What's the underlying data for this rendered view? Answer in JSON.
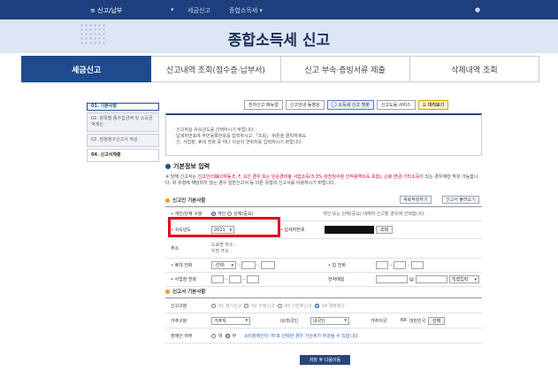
{
  "topnav": {
    "menu_label": "≡  신고/납부",
    "dropdown_mark": "▾",
    "link1": "세금신고",
    "link2": "종합소득세 ▾",
    "circle_mark": "●"
  },
  "banner": {
    "title": "종합소득세 신고"
  },
  "tabs": [
    {
      "label": "세금신고",
      "active": true
    },
    {
      "label": "신고내역 조회(접수증·납부서)",
      "active": false
    },
    {
      "label": "신고 부속·증빙서류 제출",
      "active": false
    },
    {
      "label": "삭제내역 조회",
      "active": false
    }
  ],
  "sidebar": [
    {
      "label": "01. 기본사항"
    },
    {
      "label": "02. 항목별 종수입금액 및 소득금액계산"
    },
    {
      "label": "03. 정정청구신고서 작성"
    },
    {
      "label": "04. 신고서제출"
    }
  ],
  "toolbar": [
    {
      "label": "전자신고 매뉴얼"
    },
    {
      "label": "신고안내 동영상"
    },
    {
      "label": "💬 소득세 신고 챗봇"
    },
    {
      "label": "신고도움 서비스"
    },
    {
      "label": "☰ 미리보기"
    }
  ],
  "info": {
    "line1": "· 신고하실 귀속년도를 선택하시기 바랍니다.",
    "line2": "· 납세자번호에 주민등록번호를 입력하시고 「조회」 버튼을 클릭하세요.",
    "line3": "· 신, 사업장, 휴대 전화 중 하나 이상의 연락처를 입력하시기 바랍니다."
  },
  "section_basic": {
    "title": "기본정보 입력"
  },
  "notice": {
    "prefix": "※ 당해 신고서는 ",
    "red1": "신고인(대표)/자동 E, F, G인 경우 또는 단순경비율 사업소득(3.3% 원천징수된 인적용역소득 포함), 근로·연금·기타소득",
    "suffix": "이 있는 경우에만 작성 가능합니다. 위 유형에 해당되지 않는 경우 일반신고서 등 다른 유형의 신고서를 이용하시기 바랍니다."
  },
  "section_reporter": {
    "title": "신고인 기본사항",
    "new_button": "새로작성하기",
    "load_button": "신고서 불러오기"
  },
  "form": {
    "type_label": "개인/단체 구분",
    "type_opt1": "개인",
    "type_opt2": "단체(중요)",
    "type_note": "개인 또는 단체(중요) 대해여 신고할 경우에 선택합니다.",
    "year_label": "귀속년도",
    "year_value": "2021",
    "taxpayer_label": "납세자번호",
    "lookup_button": "조회",
    "address_label": "주소",
    "address_line1": "도로명 주소 :",
    "address_line2": "지번 주소 :",
    "mobile_label": "휴대 전화",
    "mobile_select": "-선택-",
    "home_label": "집 전화",
    "biz_label": "사업장 전화",
    "email_label": "전자메일",
    "email_at": "@",
    "email_select": "직접입력"
  },
  "section_report": {
    "title": "신고서 기본사항",
    "kind_label": "신고구분",
    "kind_options": [
      "01 정기신고",
      "02 수정신고",
      "03 기한후신고",
      "04 경정청구"
    ],
    "residence_label": "거주구분",
    "residence_value": "거주자",
    "nationality_label": "내/외국인",
    "nationality_value": "내국인",
    "country_label": "거주지국",
    "country_code": "KR",
    "country_name": "대한민국",
    "country_button": "선택",
    "disabled_label": "장애인 여부",
    "disabled_no": "여",
    "disabled_yes": "부",
    "disabled_note": "※비장애인이 '여'로 선택한 경우 가산세가 부과될 수 있습니다."
  },
  "next_button": "저장 후 다음이동"
}
